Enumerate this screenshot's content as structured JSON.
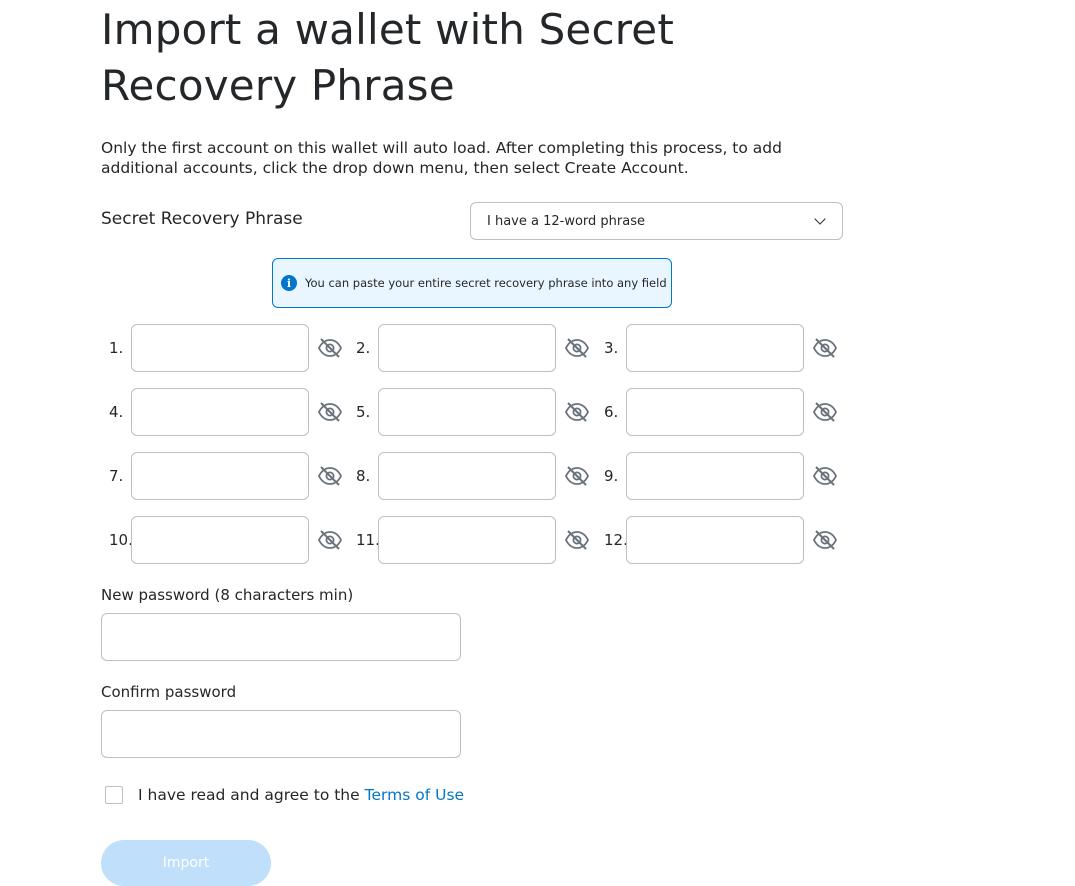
{
  "title": "Import a wallet with Secret Recovery Phrase",
  "intro": "Only the first account on this wallet will auto load. After completing this process, to add additional accounts, click the drop down menu, then select Create Account.",
  "srp": {
    "label": "Secret Recovery Phrase",
    "dropdown_value": "I have a 12-word phrase",
    "info_text": "You can paste your entire secret recovery phrase into any field",
    "words": [
      {
        "num": "1.",
        "value": ""
      },
      {
        "num": "2.",
        "value": ""
      },
      {
        "num": "3.",
        "value": ""
      },
      {
        "num": "4.",
        "value": ""
      },
      {
        "num": "5.",
        "value": ""
      },
      {
        "num": "6.",
        "value": ""
      },
      {
        "num": "7.",
        "value": ""
      },
      {
        "num": "8.",
        "value": ""
      },
      {
        "num": "9.",
        "value": ""
      },
      {
        "num": "10.",
        "value": ""
      },
      {
        "num": "11.",
        "value": ""
      },
      {
        "num": "12.",
        "value": ""
      }
    ]
  },
  "new_password": {
    "label": "New password (8 characters min)",
    "value": ""
  },
  "confirm_password": {
    "label": "Confirm password",
    "value": ""
  },
  "terms": {
    "text": "I have read and agree to the",
    "link": "Terms of Use",
    "checked": false
  },
  "import_button": "Import",
  "colors": {
    "primary": "#0376c9",
    "disabled_button": "#bfdffa",
    "border": "#bbc0c5",
    "text": "#24272a",
    "info_bg": "#eaf6ff"
  },
  "icons": {
    "info": "info-icon",
    "eye": "eye-slash-icon",
    "dropdown": "chevron-down-icon"
  }
}
